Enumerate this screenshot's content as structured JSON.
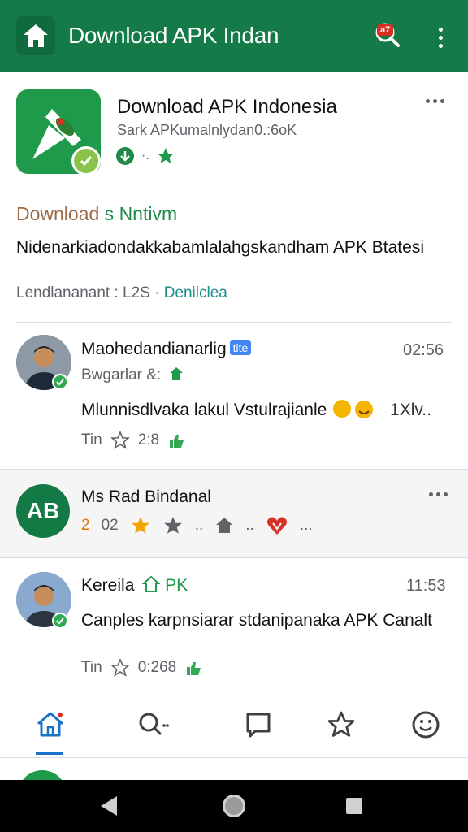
{
  "appbar": {
    "title": "Download APK Indan",
    "notification_badge": "a7",
    "icons": {
      "home": "home-icon",
      "notify": "notification-icon",
      "more": "more-vert-icon"
    },
    "color": "#137a48"
  },
  "app": {
    "name": "Download APK Indonesia",
    "subtitle": "Sark APKumalnlydan0.:6oK",
    "section_title_a": "Download",
    "section_title_b": " s Nntivm",
    "description": "Nidenarkiadondakkabamlalahgskandham APK Btatesi",
    "meta_prefix": "Lendlananant : L2S · ",
    "meta_link": "Denilclea"
  },
  "posts": [
    {
      "name": "Maohedandianarlig",
      "tag": "tite",
      "time": "02:56",
      "subtitle": "Bwgarlar &:",
      "text": "Mlunnisdlvaka lakul Vstulrajianle",
      "text_tail": "1Xlv..",
      "action_label": "Tin",
      "action_count": "2:8"
    },
    {
      "name": "Kereila",
      "badge": "PK",
      "time": "11:53",
      "text": "Canples karpnsiarar stdanipanaka APK Canalt",
      "action_label": "Tin",
      "action_count": "0:268"
    }
  ],
  "card2": {
    "logo_text": "AB",
    "name": "Ms Rad Bindanal",
    "num": "2",
    "count": "02",
    "dots": ".."
  },
  "bottom_nav": {
    "items": [
      "home-icon",
      "search-icon",
      "chat-icon",
      "star-icon",
      "emoji-icon"
    ],
    "active_color": "#1a73c8"
  }
}
